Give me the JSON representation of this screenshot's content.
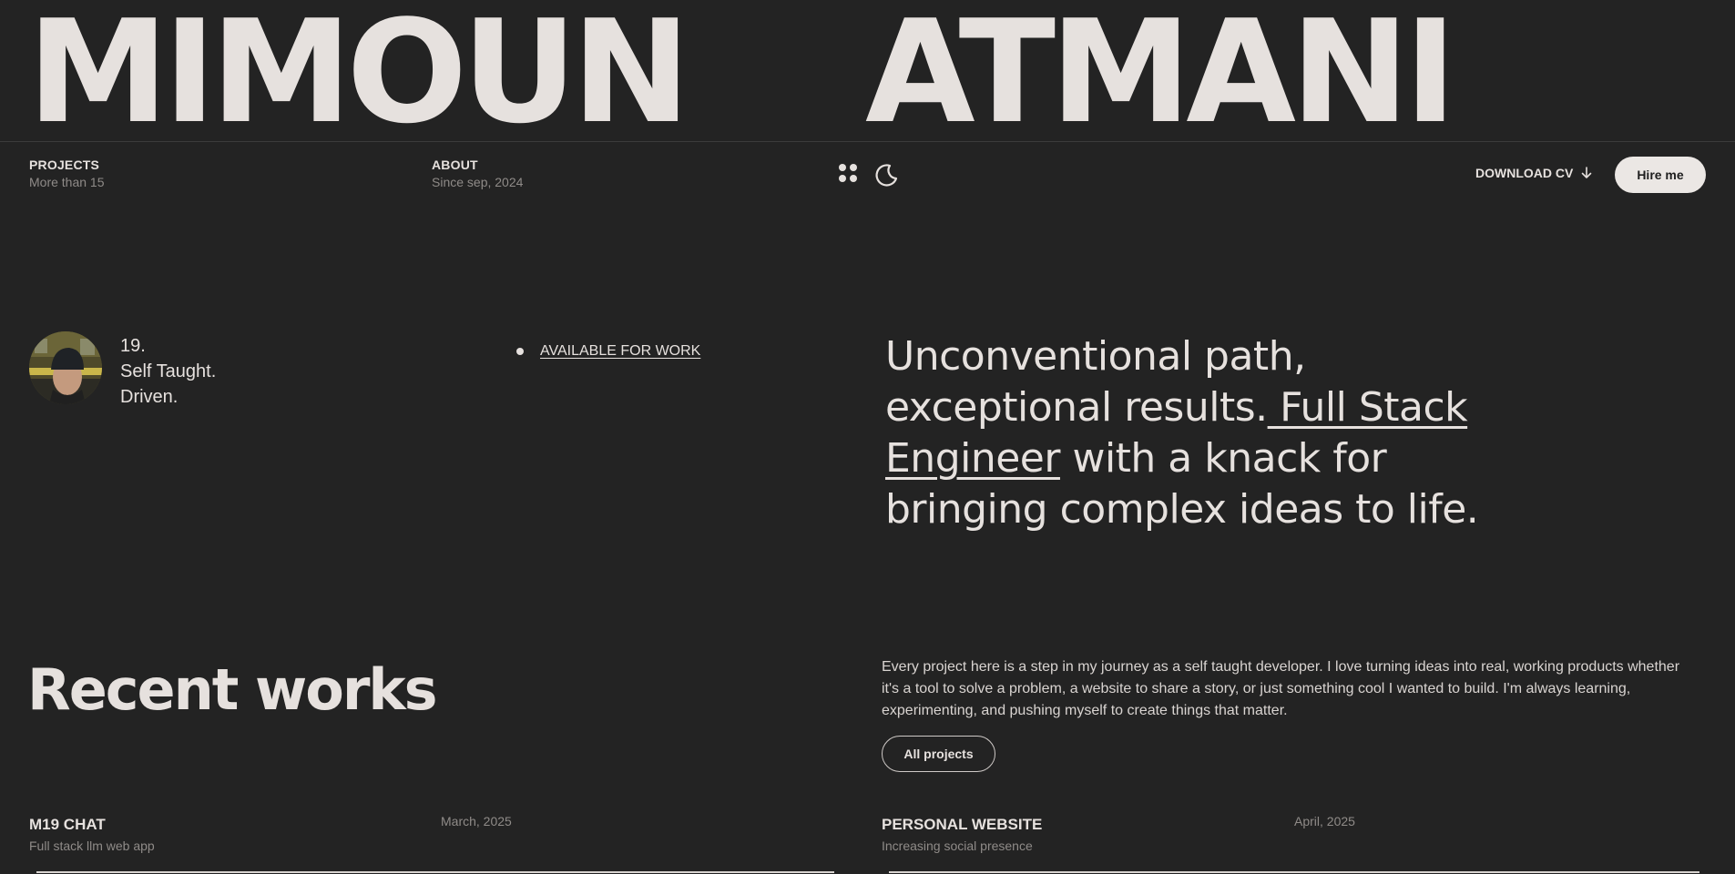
{
  "header": {
    "first_name": "MIMOUN",
    "last_name": "ATMANI"
  },
  "nav": {
    "projects": {
      "title": "PROJECTS",
      "sub": "More than 15"
    },
    "about": {
      "title": "ABOUT",
      "sub": "Since sep, 2024"
    },
    "download_cv": "DOWNLOAD CV",
    "hire_me": "Hire me"
  },
  "intro": {
    "bio_lines": [
      "19.",
      "Self Taught.",
      "Driven."
    ],
    "available": "AVAILABLE FOR WORK",
    "headline_part1": "Unconventional path, exceptional results.",
    "headline_link": " Full Stack Engineer",
    "headline_part2": " with a knack for bringing complex ideas to life."
  },
  "recent": {
    "title": "Recent works",
    "description": "Every project here is a step in my journey as a self taught developer. I love turning ideas into real, working products whether it's a tool to solve a problem, a website to share a story, or just something cool I wanted to build. I'm always learning, experimenting, and pushing myself to create things that matter.",
    "all_projects": "All projects",
    "projects": [
      {
        "name": "M19 CHAT",
        "sub": "Full stack llm web app",
        "date": "March, 2025"
      },
      {
        "name": "PERSONAL WEBSITE",
        "sub": "Increasing social presence",
        "date": "April, 2025"
      }
    ]
  },
  "colors": {
    "background": "#232323",
    "text": "#e6e1de",
    "muted": "#8f8b88",
    "button_light": "#ebe7e4"
  },
  "icons": [
    "dots-grid-icon",
    "moon-icon",
    "arrow-down-icon"
  ]
}
